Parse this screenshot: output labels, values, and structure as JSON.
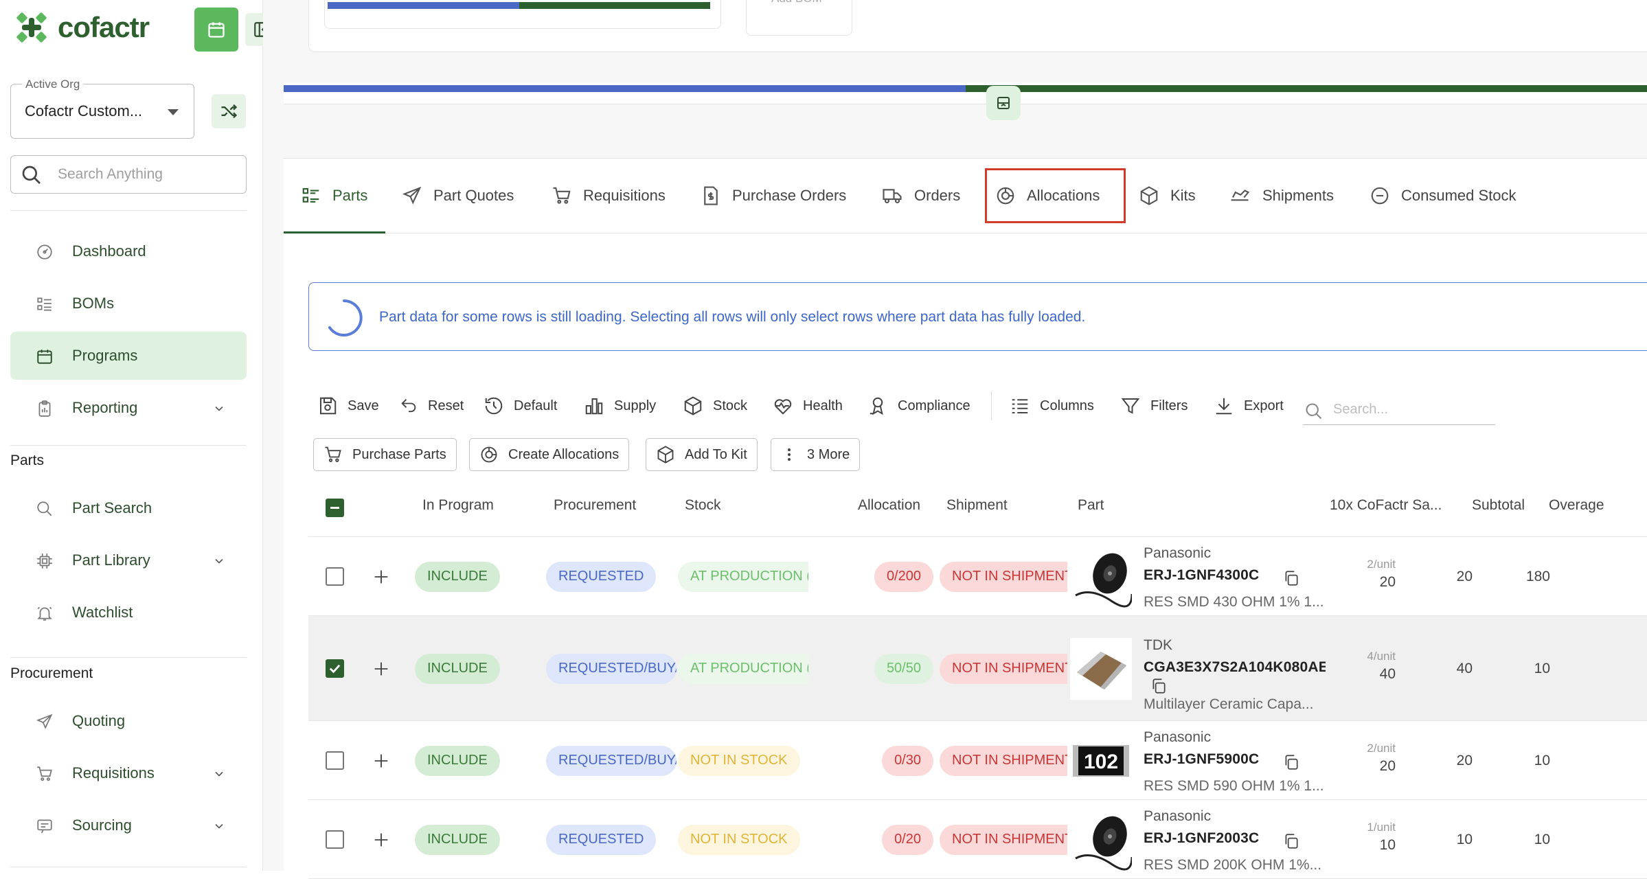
{
  "brand": {
    "name": "cofactr",
    "accent": "#2e5f2e",
    "active_bg": "#dff2df"
  },
  "sidebar": {
    "active_org_label": "Active Org",
    "active_org_value": "Cofactr Custom...",
    "search_placeholder": "Search Anything",
    "nav_top": [
      {
        "label": "Dashboard",
        "icon": "dashboard-icon"
      },
      {
        "label": "BOMs",
        "icon": "list-icon"
      },
      {
        "label": "Programs",
        "icon": "calendar-icon",
        "active": true
      },
      {
        "label": "Reporting",
        "icon": "clipboard-icon",
        "expandable": true
      }
    ],
    "section_parts": "Parts",
    "nav_parts": [
      {
        "label": "Part Search",
        "icon": "search-icon"
      },
      {
        "label": "Part Library",
        "icon": "chip-icon",
        "expandable": true
      },
      {
        "label": "Watchlist",
        "icon": "bell-icon"
      }
    ],
    "section_procurement": "Procurement",
    "nav_procurement": [
      {
        "label": "Quoting",
        "icon": "send-icon"
      },
      {
        "label": "Requisitions",
        "icon": "cart-icon",
        "expandable": true
      },
      {
        "label": "Sourcing",
        "icon": "sourcing-icon",
        "expandable": true
      }
    ]
  },
  "top_card": {
    "add_bom_label": "Add BOM",
    "progress_fraction_blue": 0.5,
    "big_progress_fraction_blue": 0.5
  },
  "tabs": [
    {
      "label": "Parts",
      "icon": "parts-list-icon",
      "active": true
    },
    {
      "label": "Part Quotes",
      "icon": "send-icon"
    },
    {
      "label": "Requisitions",
      "icon": "cart-icon"
    },
    {
      "label": "Purchase Orders",
      "icon": "invoice-icon"
    },
    {
      "label": "Orders",
      "icon": "truck-icon"
    },
    {
      "label": "Allocations",
      "icon": "pie-icon",
      "highlighted": true
    },
    {
      "label": "Kits",
      "icon": "box-icon"
    },
    {
      "label": "Shipments",
      "icon": "ship-icon"
    },
    {
      "label": "Consumed Stock",
      "icon": "minus-circle-icon"
    }
  ],
  "alert": {
    "text": "Part data for some rows is still loading. Selecting all rows will only select rows where part data has fully loaded."
  },
  "toolbar": [
    {
      "label": "Save",
      "icon": "save-icon"
    },
    {
      "label": "Reset",
      "icon": "undo-icon"
    },
    {
      "label": "Default",
      "icon": "history-icon"
    },
    {
      "label": "Supply",
      "icon": "bar-chart-icon"
    },
    {
      "label": "Stock",
      "icon": "box-icon"
    },
    {
      "label": "Health",
      "icon": "heart-pulse-icon"
    },
    {
      "label": "Compliance",
      "icon": "certificate-icon"
    },
    {
      "label": "Columns",
      "icon": "columns-icon"
    },
    {
      "label": "Filters",
      "icon": "filter-icon"
    },
    {
      "label": "Export",
      "icon": "download-icon"
    }
  ],
  "table_search_placeholder": "Search...",
  "actions": [
    {
      "label": "Purchase Parts",
      "icon": "cart-icon"
    },
    {
      "label": "Create Allocations",
      "icon": "pie-icon"
    },
    {
      "label": "Add To Kit",
      "icon": "box-icon"
    },
    {
      "label": "3 More",
      "icon": "more-vertical-icon"
    }
  ],
  "columns": [
    "In Program",
    "Procurement",
    "Stock",
    "Allocation",
    "Shipment",
    "Part",
    "10x CoFactr Sa...",
    "Subtotal",
    "Overage"
  ],
  "rows": [
    {
      "selected": false,
      "in_program": "INCLUDE",
      "procurement": "REQUESTED",
      "stock": "AT PRODUCTION (",
      "stock_kind": "prod",
      "allocation": "0/200",
      "alloc_kind": "bad",
      "shipment": "NOT IN SHIPMENT",
      "manufacturer": "Panasonic",
      "mpn": "ERJ-1GNF4300C",
      "description": "RES SMD 430 OHM 1% 1...",
      "per_unit": "2/unit",
      "qty": "20",
      "subtotal": "20",
      "overage": "180",
      "thumb": "reel"
    },
    {
      "selected": true,
      "in_program": "INCLUDE",
      "procurement": "REQUESTED/BUYA",
      "stock": "AT PRODUCTION (",
      "stock_kind": "prod",
      "allocation": "50/50",
      "alloc_kind": "ok",
      "shipment": "NOT IN SHIPMENT",
      "manufacturer": "TDK",
      "mpn": "CGA3E3X7S2A104K080AE",
      "description": "Multilayer Ceramic Capa...",
      "per_unit": "4/unit",
      "qty": "40",
      "subtotal": "40",
      "overage": "10",
      "thumb": "capacitor"
    },
    {
      "selected": false,
      "in_program": "INCLUDE",
      "procurement": "REQUESTED/BUYA",
      "stock": "NOT IN STOCK",
      "stock_kind": "none",
      "allocation": "0/30",
      "alloc_kind": "bad",
      "shipment": "NOT IN SHIPMENT",
      "manufacturer": "Panasonic",
      "mpn": "ERJ-1GNF5900C",
      "description": "RES SMD 590 OHM 1% 1...",
      "per_unit": "2/unit",
      "qty": "20",
      "subtotal": "20",
      "overage": "10",
      "thumb": "resistor",
      "thumb_text": "102"
    },
    {
      "selected": false,
      "in_program": "INCLUDE",
      "procurement": "REQUESTED",
      "stock": "NOT IN STOCK",
      "stock_kind": "none",
      "allocation": "0/20",
      "alloc_kind": "bad",
      "shipment": "NOT IN SHIPMENT",
      "manufacturer": "Panasonic",
      "mpn": "ERJ-1GNF2003C",
      "description": "RES SMD 200K OHM 1%...",
      "per_unit": "1/unit",
      "qty": "10",
      "subtotal": "10",
      "overage": "10",
      "thumb": "reel"
    }
  ]
}
